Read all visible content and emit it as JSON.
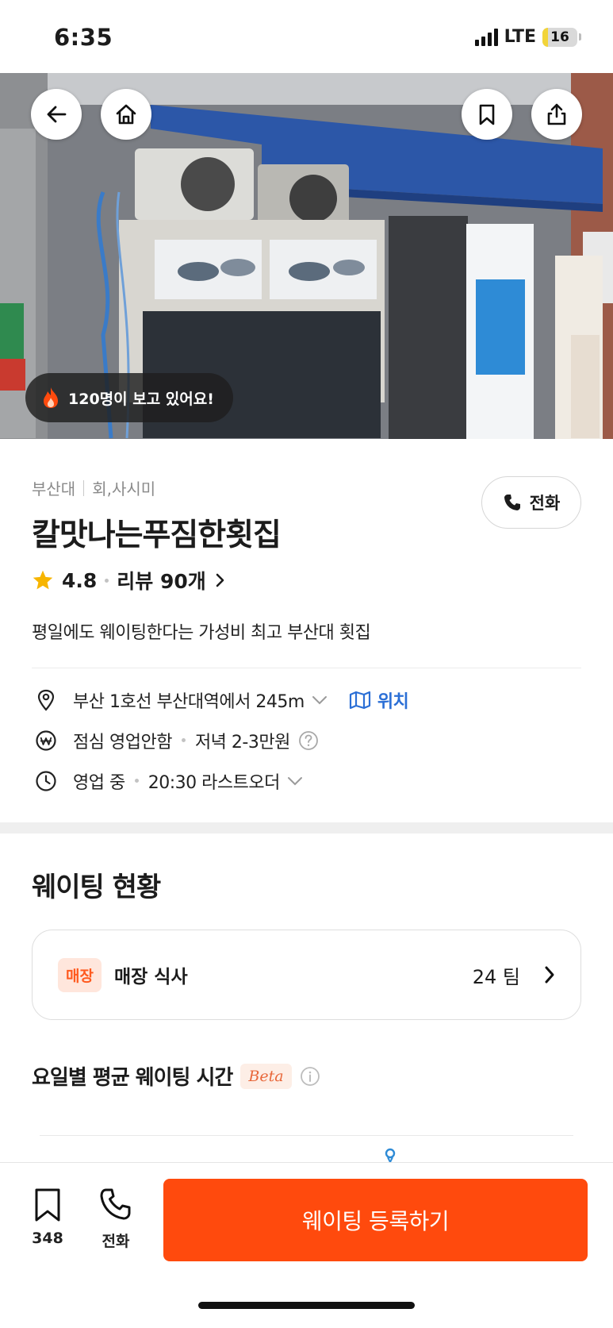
{
  "status_bar": {
    "time": "6:35",
    "network": "LTE",
    "battery": "16",
    "battery_level": 0.16
  },
  "hero": {
    "viewing_text": "120명이 보고 있어요!",
    "icons": {
      "back": "arrow-left-icon",
      "home": "home-icon",
      "bookmark": "bookmark-icon",
      "share": "share-icon",
      "viewing": "fire-icon"
    }
  },
  "place": {
    "area": "부산대",
    "category": "회,사시미",
    "name": "칼맛나는푸짐한횟집",
    "rating": "4.8",
    "reviews": "리뷰 90개",
    "tagline": "평일에도 웨이팅한다는 가성비 최고 부산대 횟집",
    "call_label": "전화"
  },
  "details": {
    "location": "부산 1호선 부산대역에서 245m",
    "location_link": "위치",
    "price_lunch": "점심 영업안함",
    "price_dinner": "저녁 2-3만원",
    "status": "영업 중",
    "last_order": "20:30 라스트오더"
  },
  "waiting": {
    "title": "웨이팅 현황",
    "badge": "매장",
    "label": "매장 식사",
    "teams": "24 팀",
    "avg_title": "요일별 평균 웨이팅 시간",
    "beta": "Beta"
  },
  "bottom_bar": {
    "bookmark_count": "348",
    "call_label": "전화",
    "cta": "웨이팅 등록하기"
  },
  "colors": {
    "accent": "#ff4a0d",
    "link": "#2b6fd6",
    "star": "#f7b500"
  }
}
